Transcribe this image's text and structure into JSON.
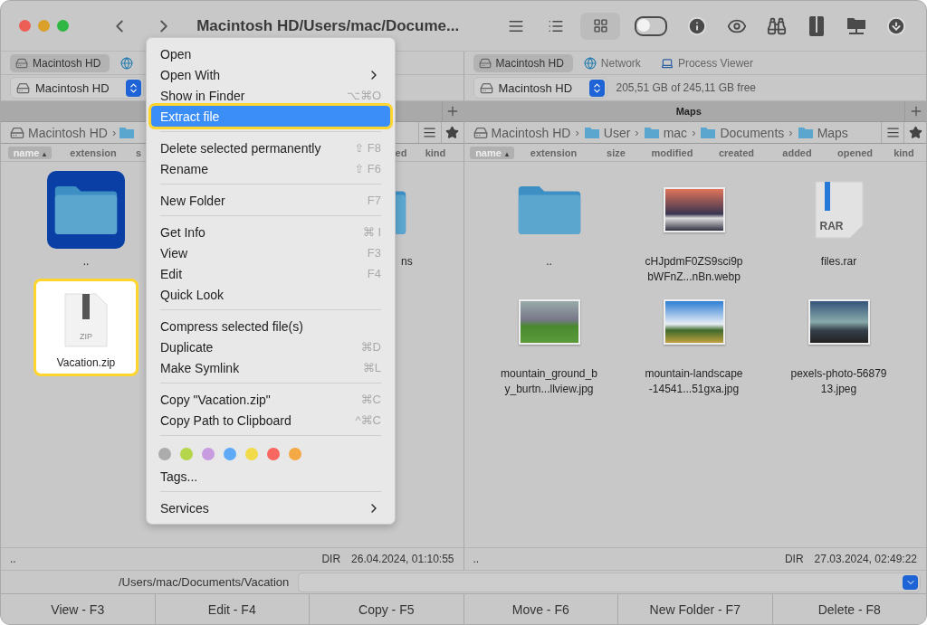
{
  "window": {
    "title": "Macintosh HD/Users/mac/Docume..."
  },
  "view_buttons": [
    {
      "kind": "lines",
      "selected": false
    },
    {
      "kind": "details",
      "selected": false
    },
    {
      "kind": "grid",
      "selected": true
    }
  ],
  "toggle": {
    "on": false
  },
  "left_panel": {
    "drive_tabs": [
      {
        "label": "Macintosh HD",
        "kind": "disk",
        "selected": true
      },
      {
        "kind": "globe",
        "selected": false
      }
    ],
    "drive_select": {
      "value": "Macintosh HD"
    },
    "breadcrumb": [
      {
        "label": "Macintosh HD",
        "kind": "disk"
      },
      {
        "kind": "folder",
        "separator": "›"
      }
    ],
    "columns": [
      {
        "label": "name",
        "sort_mark": "▴",
        "sorted": true
      },
      {
        "label": "extension",
        "sorted": false
      },
      {
        "label": "s",
        "sorted": false
      },
      {
        "label": "ed",
        "sorted": false
      },
      {
        "label": "kind",
        "sorted": false
      }
    ],
    "files": [
      {
        "name": "..",
        "kind": "folder",
        "selected": true,
        "highlighted": false
      },
      {
        "name": "ns",
        "kind": "folder",
        "selected": false,
        "highlighted": false
      },
      {
        "name": "Vacation.zip",
        "kind": "zip",
        "badge": "ZIP",
        "selected": false,
        "highlighted": true
      }
    ],
    "status": {
      "name": "..",
      "type": "DIR",
      "date": "26.04.2024, 01:10:55"
    }
  },
  "right_panel": {
    "drive_tabs": [
      {
        "label": "Macintosh HD",
        "kind": "disk",
        "selected": true
      },
      {
        "label": "Network",
        "kind": "globe",
        "selected": false
      },
      {
        "label": "Process Viewer",
        "kind": "laptop",
        "selected": false
      }
    ],
    "drive_select": {
      "value": "Macintosh HD"
    },
    "free_space": "205,51 GB of 245,11 GB free",
    "tab": "Maps",
    "breadcrumb": [
      {
        "label": "Macintosh HD",
        "kind": "disk"
      },
      {
        "label": "User",
        "kind": "folder",
        "separator": "›"
      },
      {
        "label": "mac",
        "kind": "folder",
        "separator": "›"
      },
      {
        "label": "Documents",
        "kind": "folder",
        "separator": "›"
      },
      {
        "label": "Maps",
        "kind": "folder",
        "separator": "›"
      }
    ],
    "columns": [
      {
        "label": "name",
        "sort_mark": "▴",
        "sorted": true
      },
      {
        "label": "extension",
        "sorted": false
      },
      {
        "label": "size",
        "sorted": false
      },
      {
        "label": "modified",
        "sorted": false
      },
      {
        "label": "created",
        "sorted": false
      },
      {
        "label": "added",
        "sorted": false
      },
      {
        "label": "opened",
        "sorted": false
      },
      {
        "label": "kind",
        "sorted": false
      }
    ],
    "files": [
      {
        "name": "..",
        "kind": "folder",
        "selected": false,
        "highlighted": false
      },
      {
        "name": "cHJpdmF0ZS9sci9pbWFnZ...nBn.webp",
        "kind": "photo",
        "selected": false,
        "highlighted": false
      },
      {
        "name": "files.rar",
        "kind": "archive",
        "badge": "RAR",
        "selected": false,
        "highlighted": false
      },
      {
        "name": "mountain_ground_by_burtn...llview.jpg",
        "kind": "photo",
        "selected": false,
        "highlighted": false
      },
      {
        "name": "mountain-landscape-14541...51gxa.jpg",
        "kind": "photo",
        "selected": false,
        "highlighted": false
      },
      {
        "name": "pexels-photo-5687913.jpeg",
        "kind": "photo",
        "selected": false,
        "highlighted": false
      }
    ],
    "status": {
      "name": "..",
      "type": "DIR",
      "date": "27.03.2024, 02:49:22"
    }
  },
  "command_line": {
    "path": "/Users/mac/Documents/Vacation"
  },
  "function_keys": [
    "View - F3",
    "Edit - F4",
    "Copy - F5",
    "Move - F6",
    "New Folder - F7",
    "Delete - F8"
  ],
  "context_menu": {
    "items": [
      {
        "kind": "item",
        "label": "Open",
        "highlighted": false,
        "submenu": false
      },
      {
        "kind": "item",
        "label": "Open With",
        "highlighted": false,
        "submenu": true
      },
      {
        "kind": "item",
        "label": "Show in Finder",
        "shortcut": "⌥⌘O",
        "highlighted": false,
        "submenu": false
      },
      {
        "kind": "item",
        "label": "Extract file",
        "highlighted": true,
        "submenu": false
      },
      {
        "kind": "separator"
      },
      {
        "kind": "item",
        "label": "Delete selected permanently",
        "shortcut": "⇧ F8",
        "highlighted": false,
        "submenu": false
      },
      {
        "kind": "item",
        "label": "Rename",
        "shortcut": "⇧ F6",
        "highlighted": false,
        "submenu": false
      },
      {
        "kind": "separator"
      },
      {
        "kind": "item",
        "label": "New Folder",
        "shortcut": "F7",
        "highlighted": false,
        "submenu": false
      },
      {
        "kind": "separator"
      },
      {
        "kind": "item",
        "label": "Get Info",
        "shortcut": "⌘ I",
        "highlighted": false,
        "submenu": false
      },
      {
        "kind": "item",
        "label": "View",
        "shortcut": "F3",
        "highlighted": false,
        "submenu": false
      },
      {
        "kind": "item",
        "label": "Edit",
        "shortcut": "F4",
        "highlighted": false,
        "submenu": false
      },
      {
        "kind": "item",
        "label": "Quick Look",
        "highlighted": false,
        "submenu": false
      },
      {
        "kind": "separator"
      },
      {
        "kind": "item",
        "label": "Compress selected file(s)",
        "highlighted": false,
        "submenu": false
      },
      {
        "kind": "item",
        "label": "Duplicate",
        "shortcut": "⌘D",
        "highlighted": false,
        "submenu": false
      },
      {
        "kind": "item",
        "label": "Make Symlink",
        "shortcut": "⌘L",
        "highlighted": false,
        "submenu": false
      },
      {
        "kind": "separator"
      },
      {
        "kind": "item",
        "label": "Copy \"Vacation.zip\"",
        "shortcut": "⌘C",
        "highlighted": false,
        "submenu": false
      },
      {
        "kind": "item",
        "label": "Copy Path to Clipboard",
        "shortcut": "^⌘C",
        "highlighted": false,
        "submenu": false
      },
      {
        "kind": "separator"
      },
      {
        "kind": "tags",
        "dots": [
          {
            "color": "#acacac"
          },
          {
            "color": "#b5d64a"
          },
          {
            "color": "#c99be0"
          },
          {
            "color": "#5eaaf7"
          },
          {
            "color": "#f2db4b"
          },
          {
            "color": "#f7675f"
          },
          {
            "color": "#f5a944"
          }
        ]
      },
      {
        "kind": "item",
        "label": "Tags...",
        "highlighted": false,
        "submenu": false
      },
      {
        "kind": "separator"
      },
      {
        "kind": "item",
        "label": "Services",
        "highlighted": false,
        "submenu": true
      }
    ]
  }
}
